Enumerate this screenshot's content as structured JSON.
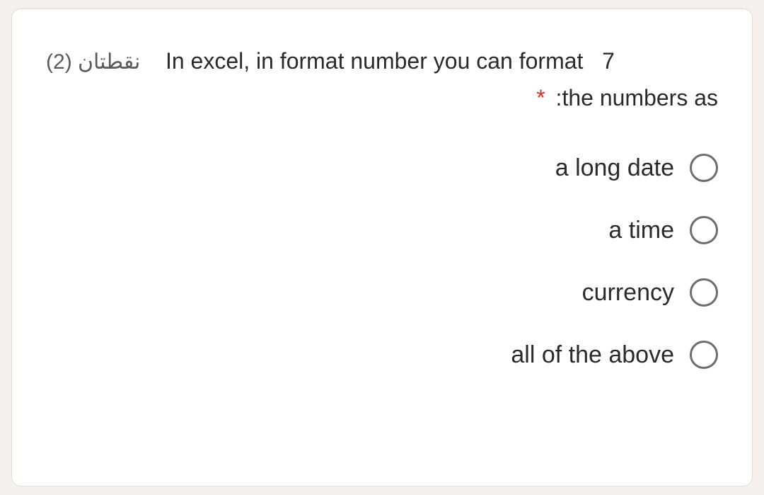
{
  "question": {
    "number": "7",
    "points_text": "نقطتان (2)",
    "text_part1": "In excel, in format number you can format",
    "text_part2": ":the numbers as",
    "required_marker": "*"
  },
  "options": [
    {
      "label": "a long date"
    },
    {
      "label": "a time"
    },
    {
      "label": "currency"
    },
    {
      "label": "all of the above"
    }
  ]
}
